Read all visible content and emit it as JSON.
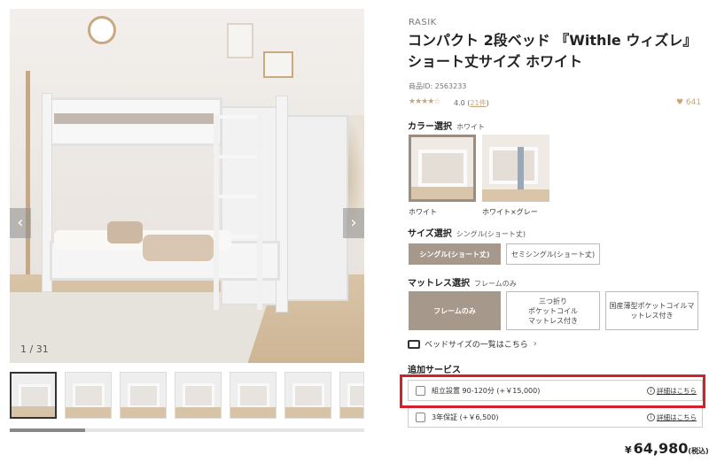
{
  "gallery": {
    "counter": "1 / 31",
    "prev_arrow": "‹",
    "next_arrow": "›"
  },
  "product": {
    "brand": "RASIK",
    "title": "コンパクト 2段ベッド 『Withle ウィズレ』 ショート丈サイズ ホワイト",
    "product_id": "商品ID: 2563233",
    "stars": "★★★★☆",
    "rating": "4.0",
    "rating_count": "21件",
    "likes": "♥ 641"
  },
  "color": {
    "label": "カラー選択",
    "selected": "ホワイト",
    "options": [
      "ホワイト",
      "ホワイト×グレー"
    ]
  },
  "size": {
    "label": "サイズ選択",
    "selected": "シングル(ショート丈)",
    "options": [
      "シングル(ショート丈)",
      "セミシングル(ショート丈)"
    ]
  },
  "mattress": {
    "label": "マットレス選択",
    "selected": "フレームのみ",
    "options": [
      "フレームのみ",
      "三つ折り\nポケットコイル\nマットレス付き",
      "国産薄型ポケットコイルマ\nットレス付き"
    ]
  },
  "bed_size_link": "ベッドサイズの一覧はこちら",
  "services": {
    "label": "追加サービス",
    "items": [
      {
        "label": "組立設置 90-120分 (+￥15,000)",
        "detail": "詳細はこちら"
      },
      {
        "label": "3年保証 (+￥6,500)",
        "detail": "詳細はこちら"
      }
    ]
  },
  "price": {
    "yen": "¥",
    "amount": "64,980",
    "tax": "(税込)"
  },
  "colors": {
    "accent": "#a6988a",
    "highlight": "#d3202a",
    "star": "#c9a57a"
  }
}
